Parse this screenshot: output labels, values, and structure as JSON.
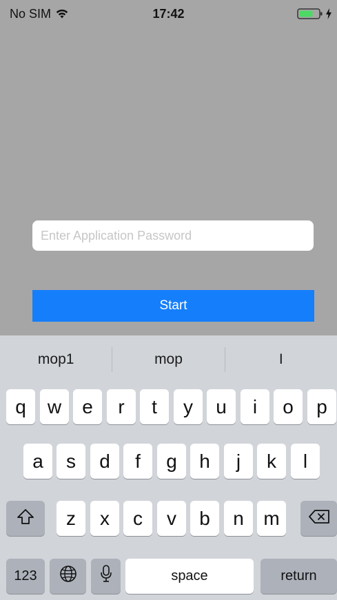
{
  "status_bar": {
    "carrier": "No SIM",
    "time": "17:42",
    "icons": [
      "wifi-icon",
      "battery-icon",
      "charging-icon"
    ],
    "battery_color": "#4cd964"
  },
  "login": {
    "password_placeholder": "Enter Application Password",
    "start_label": "Start",
    "accent_color": "#157efb"
  },
  "keyboard": {
    "suggestions": [
      "mop1",
      "mop",
      "I"
    ],
    "row1": [
      "q",
      "w",
      "e",
      "r",
      "t",
      "y",
      "u",
      "i",
      "o",
      "p"
    ],
    "row2": [
      "a",
      "s",
      "d",
      "f",
      "g",
      "h",
      "j",
      "k",
      "l"
    ],
    "row3": [
      "z",
      "x",
      "c",
      "v",
      "b",
      "n",
      "m"
    ],
    "shift_icon": "shift-icon",
    "delete_icon": "delete-icon",
    "numbers_label": "123",
    "globe_icon": "globe-icon",
    "mic_icon": "microphone-icon",
    "space_label": "space",
    "return_label": "return"
  }
}
